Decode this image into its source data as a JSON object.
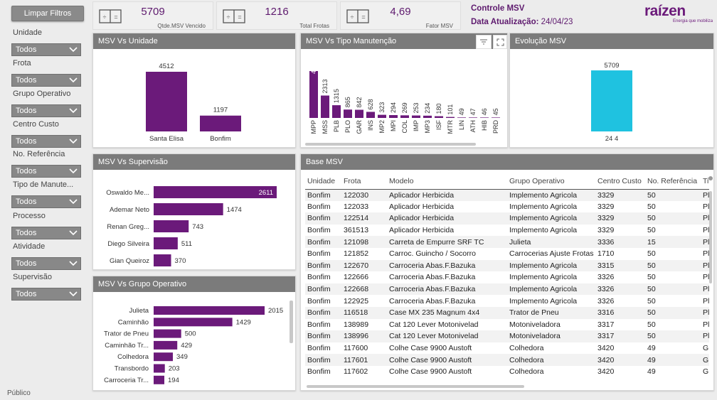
{
  "sidebar": {
    "clear_button": "Limpar Filtros",
    "filters": [
      {
        "label": "Unidade",
        "value": "Todos"
      },
      {
        "label": "Frota",
        "value": "Todos"
      },
      {
        "label": "Grupo Operativo",
        "value": "Todos"
      },
      {
        "label": "Centro Custo",
        "value": "Todos"
      },
      {
        "label": "No. Referência",
        "value": "Todos"
      },
      {
        "label": "Tipo de Manute...",
        "value": "Todos"
      },
      {
        "label": "Processo",
        "value": "Todos"
      },
      {
        "label": "Atividade",
        "value": "Todos"
      },
      {
        "label": "Supervisão",
        "value": "Todos"
      }
    ],
    "footer": "Público"
  },
  "kpis": [
    {
      "value": "5709",
      "caption": "Qtde.MSV Vencido",
      "icon": "calculator-icon"
    },
    {
      "value": "1216",
      "caption": "Total Frotas",
      "icon": "calculator-icon"
    },
    {
      "value": "4,69",
      "caption": "Fator MSV",
      "icon": "calculator-icon"
    }
  ],
  "header": {
    "title": "Controle MSV",
    "update_label": "Data Atualização:",
    "update_date": "24/04/23",
    "brand": "raízen",
    "tagline": "Energia que mobiliza"
  },
  "panels": {
    "unidade": "MSV Vs Unidade",
    "tipo": "MSV Vs Tipo Manutenção",
    "evolucao": "Evolução MSV",
    "supervisao": "MSV Vs Supervisão",
    "grupo": "MSV Vs Grupo Operativo",
    "base": "Base MSV"
  },
  "colors": {
    "purple": "#6b1a7a",
    "cyan": "#1fc2e0",
    "header_gray": "#7b7b7b"
  },
  "chart_data": [
    {
      "type": "bar",
      "id": "unidade",
      "categories": [
        "Santa Elisa",
        "Bonfim"
      ],
      "values": [
        4512,
        1197
      ]
    },
    {
      "type": "bar",
      "id": "tipo",
      "categories": [
        "MPP",
        "MSS",
        "PLB",
        "PLO",
        "GAR",
        "INS",
        "MP2",
        "MPI",
        "COL",
        "IMP",
        "MP3",
        "ISF",
        "MTR",
        "LIN",
        "ATH",
        "HIB",
        "PRD"
      ],
      "values": [
        4842,
        2313,
        1315,
        865,
        842,
        628,
        323,
        294,
        269,
        253,
        234,
        180,
        101,
        49,
        47,
        46,
        45
      ]
    },
    {
      "type": "bar",
      "id": "evolucao",
      "categories": [
        "24 4"
      ],
      "values": [
        5709
      ]
    },
    {
      "type": "bar",
      "id": "supervisao",
      "categories": [
        "Oswaldo Me...",
        "Ademar Neto",
        "Renan Greg...",
        "Diego Silveira",
        "Gian Queiroz"
      ],
      "values": [
        2611,
        1474,
        743,
        511,
        370
      ]
    },
    {
      "type": "bar",
      "id": "grupo",
      "categories": [
        "Julieta",
        "Caminhão",
        "Trator de Pneu",
        "Caminhão Tr...",
        "Colhedora",
        "Transbordo",
        "Carroceria Tr..."
      ],
      "values": [
        2015,
        1429,
        500,
        429,
        349,
        203,
        194
      ]
    }
  ],
  "table": {
    "columns": [
      "Unidade",
      "Frota",
      "Modelo",
      "Grupo Operativo",
      "Centro Custo",
      "No. Referência",
      "Ti"
    ],
    "rows": [
      [
        "Bonfim",
        "122030",
        "Aplicador Herbicida",
        "Implemento Agricola",
        "3329",
        "50",
        "Pl"
      ],
      [
        "Bonfim",
        "122033",
        "Aplicador Herbicida",
        "Implemento Agricola",
        "3329",
        "50",
        "Pl"
      ],
      [
        "Bonfim",
        "122514",
        "Aplicador Herbicida",
        "Implemento Agricola",
        "3329",
        "50",
        "Pl"
      ],
      [
        "Bonfim",
        "361513",
        "Aplicador Herbicida",
        "Implemento Agricola",
        "3329",
        "50",
        "Pl"
      ],
      [
        "Bonfim",
        "121098",
        "Carreta de Empurre SRF TC",
        "Julieta",
        "3336",
        "15",
        "Pl"
      ],
      [
        "Bonfim",
        "121852",
        "Carroc. Guincho / Socorro",
        "Carrocerias Ajuste Frotas",
        "1710",
        "50",
        "Pl"
      ],
      [
        "Bonfim",
        "122670",
        "Carroceria Abas.F.Bazuka",
        "Implemento Agricola",
        "3315",
        "50",
        "Pl"
      ],
      [
        "Bonfim",
        "122666",
        "Carroceria Abas.F.Bazuka",
        "Implemento Agricola",
        "3326",
        "50",
        "Pl"
      ],
      [
        "Bonfim",
        "122668",
        "Carroceria Abas.F.Bazuka",
        "Implemento Agricola",
        "3326",
        "50",
        "Pl"
      ],
      [
        "Bonfim",
        "122925",
        "Carroceria Abas.F.Bazuka",
        "Implemento Agricola",
        "3326",
        "50",
        "Pl"
      ],
      [
        "Bonfim",
        "116518",
        "Case MX 235 Magnum 4x4",
        "Trator de Pneu",
        "3316",
        "50",
        "Pl"
      ],
      [
        "Bonfim",
        "138989",
        "Cat 120 Lever Motonivelad",
        "Motoniveladora",
        "3317",
        "50",
        "Pl"
      ],
      [
        "Bonfim",
        "138996",
        "Cat 120 Lever Motonivelad",
        "Motoniveladora",
        "3317",
        "50",
        "Pl"
      ],
      [
        "Bonfim",
        "117600",
        "Colhe Case 9900 Austoft",
        "Colhedora",
        "3420",
        "49",
        "G"
      ],
      [
        "Bonfim",
        "117601",
        "Colhe Case 9900 Austoft",
        "Colhedora",
        "3420",
        "49",
        "G"
      ],
      [
        "Bonfim",
        "117602",
        "Colhe Case 9900 Austoft",
        "Colhedora",
        "3420",
        "49",
        "G"
      ]
    ]
  }
}
